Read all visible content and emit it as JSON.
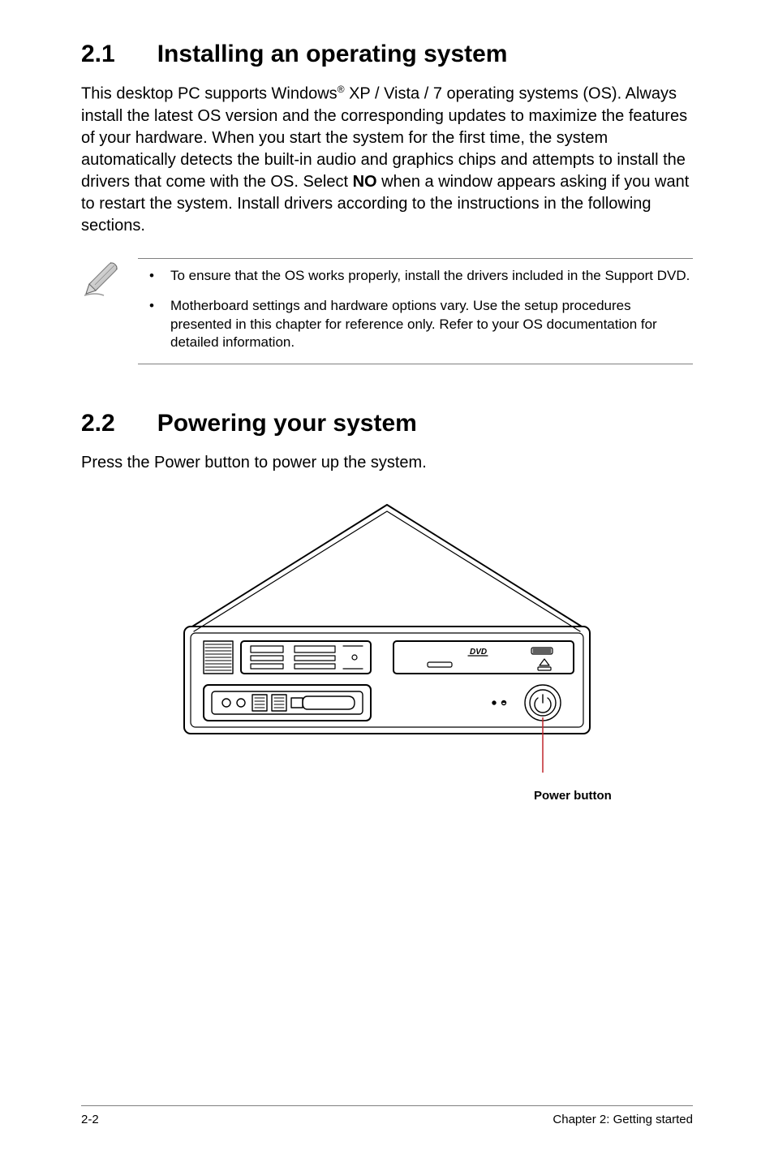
{
  "section1": {
    "number": "2.1",
    "title": "Installing an operating system",
    "body_pre": "This desktop PC supports Windows",
    "body_sup": "®",
    "body_mid": " XP / Vista / 7 operating systems (OS). Always install the latest OS version and the corresponding updates to maximize the features of your hardware. When you start the system for the first time, the system automatically detects the built-in audio and graphics chips and attempts to install the drivers that come with the OS. Select ",
    "body_bold": "NO",
    "body_post": " when a window appears asking if you want to restart the system. Install drivers according to the instructions in the following sections."
  },
  "notes": [
    "To ensure that the OS works properly, install the drivers included in the Support DVD.",
    "Motherboard settings and hardware options vary. Use the setup procedures presented in this chapter for reference only. Refer to your OS documentation for detailed information."
  ],
  "section2": {
    "number": "2.2",
    "title": "Powering your system",
    "body": "Press the Power button to power up the system."
  },
  "diagram": {
    "power_label": "Power button"
  },
  "footer": {
    "left": "2-2",
    "right": "Chapter 2: Getting started"
  }
}
